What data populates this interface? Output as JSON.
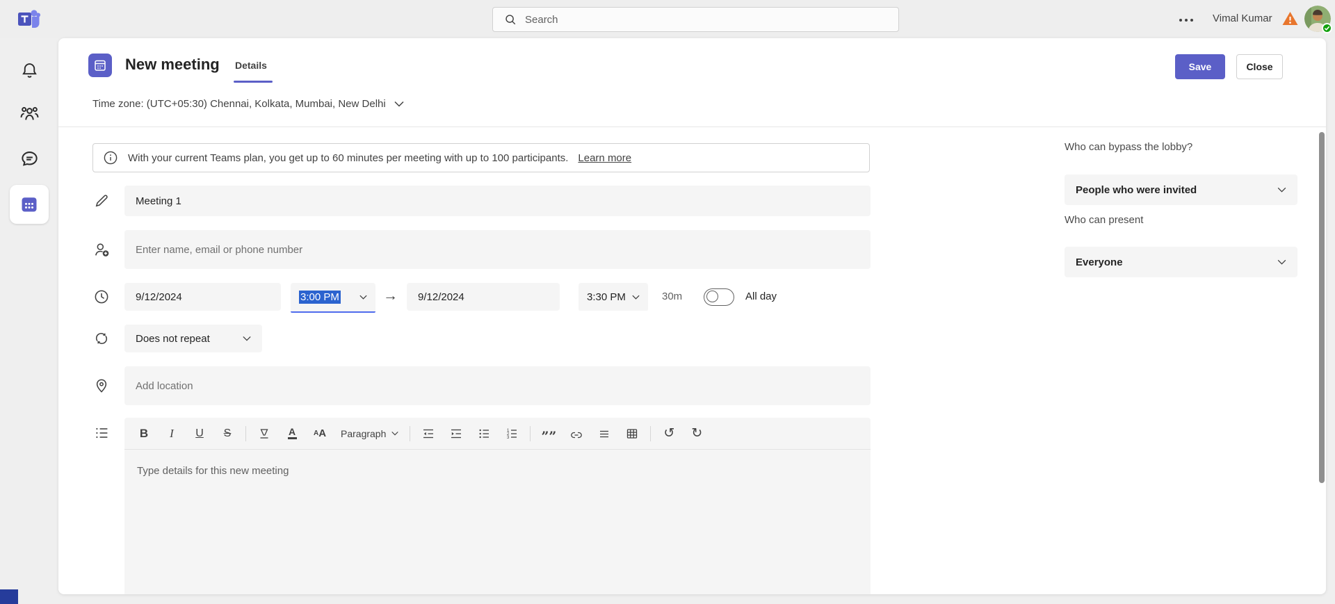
{
  "top_bar": {
    "search_placeholder": "Search",
    "user_name": "Vimal Kumar"
  },
  "header": {
    "title": "New meeting",
    "tab_details": "Details",
    "save_label": "Save",
    "close_label": "Close",
    "timezone": "Time zone: (UTC+05:30) Chennai, Kolkata, Mumbai, New Delhi"
  },
  "banner": {
    "message": "With your current Teams plan, you get up to 60 minutes per meeting with up to 100 participants.",
    "link_label": "Learn more"
  },
  "form": {
    "title_value": "Meeting 1",
    "attendees_placeholder": "Enter name, email or phone number",
    "start_date": "9/12/2024",
    "start_time": "3:00 PM",
    "arrow": "→",
    "end_date": "9/12/2024",
    "end_time": "3:30 PM",
    "duration": "30m",
    "all_day_label": "All day",
    "repeat_value": "Does not repeat",
    "location_placeholder": "Add location",
    "description_placeholder": "Type details for this new meeting"
  },
  "editor_toolbar": {
    "bold": "B",
    "italic": "I",
    "underline": "U",
    "strikethrough": "S",
    "font_color": "A",
    "font_size_small": "A",
    "font_size_large": "A",
    "paragraph": "Paragraph",
    "quote": "””",
    "undo": "↺",
    "redo": "↻"
  },
  "side_panel": {
    "lobby_label": "Who can bypass the lobby?",
    "lobby_value": "People who were invited",
    "present_label": "Who can present",
    "present_value": "Everyone"
  },
  "colors": {
    "brand": "#5B5FC7",
    "selection": "#2b63cf",
    "focus_underline": "#4f6bed",
    "warning": "#E8762D",
    "presence_available": "#13A10E",
    "field_background": "#f5f5f5",
    "page_background": "#efefef"
  }
}
